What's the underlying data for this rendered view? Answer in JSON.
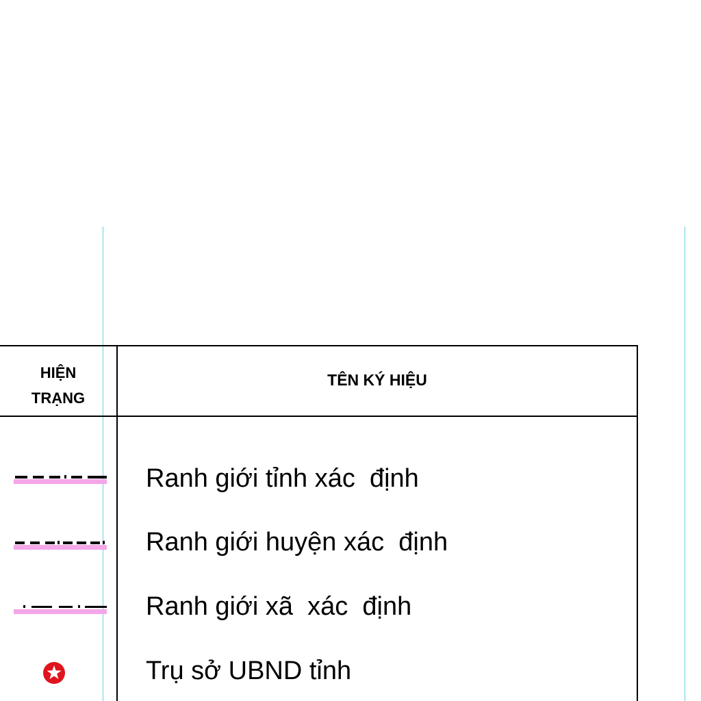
{
  "legend": {
    "header": {
      "status_line1": "HIỆN",
      "status_line2": "TRẠNG",
      "symbol_name": "TÊN KÝ HIỆU"
    },
    "rows": [
      {
        "label": "Ranh giới tỉnh xác  định",
        "symbol": "province-boundary-line"
      },
      {
        "label": "Ranh giới huyện xác  định",
        "symbol": "district-boundary-line"
      },
      {
        "label": "Ranh giới xã  xác  định",
        "symbol": "commune-boundary-line"
      },
      {
        "label": "Trụ sở UBND tỉnh",
        "symbol": "red-star-icon"
      }
    ]
  },
  "colors": {
    "boundary_band": "#f4a6e8",
    "line": "#000000",
    "star_fill": "#e0141e",
    "guide": "#5fd3e8"
  }
}
